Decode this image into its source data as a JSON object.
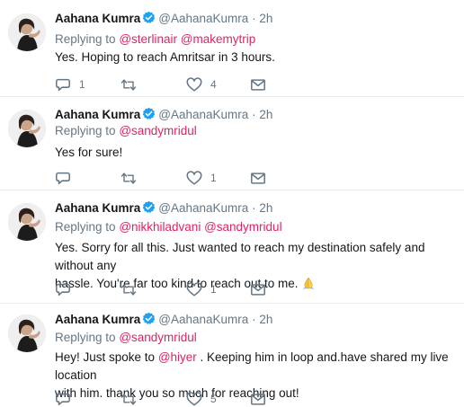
{
  "colors": {
    "mention": "#e0245e",
    "muted": "#657786",
    "verified": "#1da1f2",
    "divider": "#e6ecf0"
  },
  "tweets": [
    {
      "name": "Aahana Kumra",
      "handle": "@AahanaKumra",
      "dot": "·",
      "time": "2h",
      "replying_prefix": "Replying to",
      "mentions": [
        "@sterlinair",
        "@makemytrip"
      ],
      "text": "Yes. Hoping to reach Amritsar in 3 hours.",
      "reply_count": "1",
      "retweet_count": "",
      "like_count": "4"
    },
    {
      "name": "Aahana Kumra",
      "handle": "@AahanaKumra",
      "dot": "·",
      "time": "2h",
      "replying_prefix": "Replying to",
      "mentions": [
        "@sandymridul"
      ],
      "text": "Yes for sure!",
      "reply_count": "",
      "retweet_count": "",
      "like_count": "1"
    },
    {
      "name": "Aahana Kumra",
      "handle": "@AahanaKumra",
      "dot": "·",
      "time": "2h",
      "replying_prefix": "Replying to",
      "mentions": [
        "@nikkhiladvani",
        "@sandymridul"
      ],
      "text_line1": "Yes. Sorry for all this. Just wanted to reach my destination safely and without any",
      "text_line2": "hassle. You're far too kind to reach out to me.",
      "reply_count": "",
      "retweet_count": "",
      "like_count": "1"
    },
    {
      "name": "Aahana Kumra",
      "handle": "@AahanaKumra",
      "dot": "·",
      "time": "2h",
      "replying_prefix": "Replying to",
      "mentions": [
        "@sandymridul"
      ],
      "text_before": "Hey! Just spoke to ",
      "text_mention": "@hiyer",
      "text_after": " . Keeping him in loop and.have shared my live location",
      "text_line2": "with him. thank you so much for reaching out!",
      "reply_count": "",
      "retweet_count": "",
      "like_count": "5"
    }
  ],
  "icons": {
    "reply": "reply-icon",
    "retweet": "retweet-icon",
    "like": "heart-icon",
    "message": "envelope-icon",
    "verified": "verified-badge-icon",
    "emoji": "folded-hands-emoji"
  }
}
